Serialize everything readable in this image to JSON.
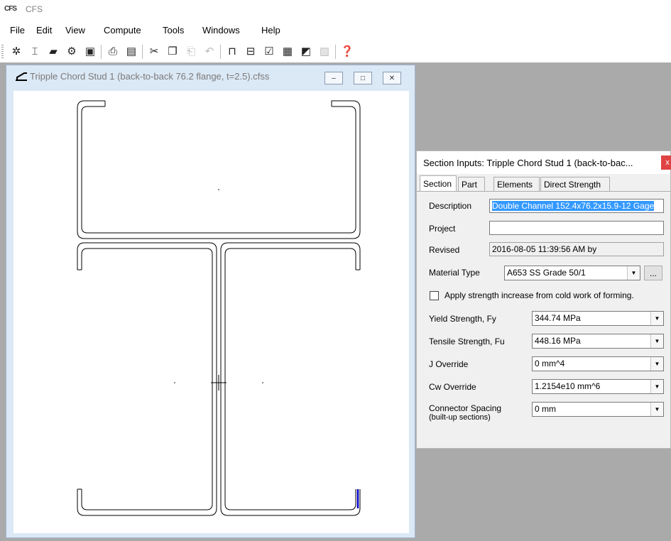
{
  "app": {
    "icon_text": "CFS",
    "title": "CFS"
  },
  "menu": [
    "File",
    "Edit",
    "View",
    "Compute",
    "Tools",
    "Windows",
    "Help"
  ],
  "toolbar_icons": [
    "new-icon",
    "new-section-icon",
    "open-icon",
    "wizard-icon",
    "save-icon",
    "print-preview-icon",
    "print-icon",
    "cut-icon",
    "copy-icon",
    "paste-icon",
    "undo-icon",
    "section-icon",
    "member-icon",
    "check-icon",
    "report-icon",
    "graph-icon",
    "chart-icon",
    "help-icon"
  ],
  "child_window": {
    "title": "Tripple Chord Stud 1 (back-to-back 76.2 flange, t=2.5).cfss",
    "minimize": "–",
    "maximize": "□",
    "close": "✕"
  },
  "dialog": {
    "title": "Section Inputs: Tripple Chord Stud 1 (back-to-bac...",
    "close": "x",
    "tabs": [
      "Section",
      "Part",
      "Elements",
      "Direct Strength"
    ],
    "active_tab": "Section",
    "description_label": "Description",
    "description_value": "Double Channel 152.4x76.2x15.9-12 Gage",
    "project_label": "Project",
    "project_value": "",
    "revised_label": "Revised",
    "revised_value": "2016-08-05 11:39:56 AM by",
    "material_label": "Material Type",
    "material_value": "A653 SS Grade 50/1",
    "material_button": "...",
    "apply_strength_label": "Apply strength increase from cold work of forming.",
    "apply_strength_checked": false,
    "fy_label": "Yield Strength, Fy",
    "fy_value": "344.74 MPa",
    "fu_label": "Tensile Strength, Fu",
    "fu_value": "448.16 MPa",
    "j_label": "J Override",
    "j_value": "0 mm^4",
    "cw_label": "Cw Override",
    "cw_value": "1.2154e10 mm^6",
    "conn_label_1": "Connector Spacing",
    "conn_label_2": "(built-up sections)",
    "conn_value": "0 mm"
  },
  "colors": {
    "workspace": "#abaaab",
    "child_bg": "#dbe8f5",
    "selection": "#3399ff",
    "close_red": "#e04343",
    "highlight_element": "#0000cc"
  }
}
